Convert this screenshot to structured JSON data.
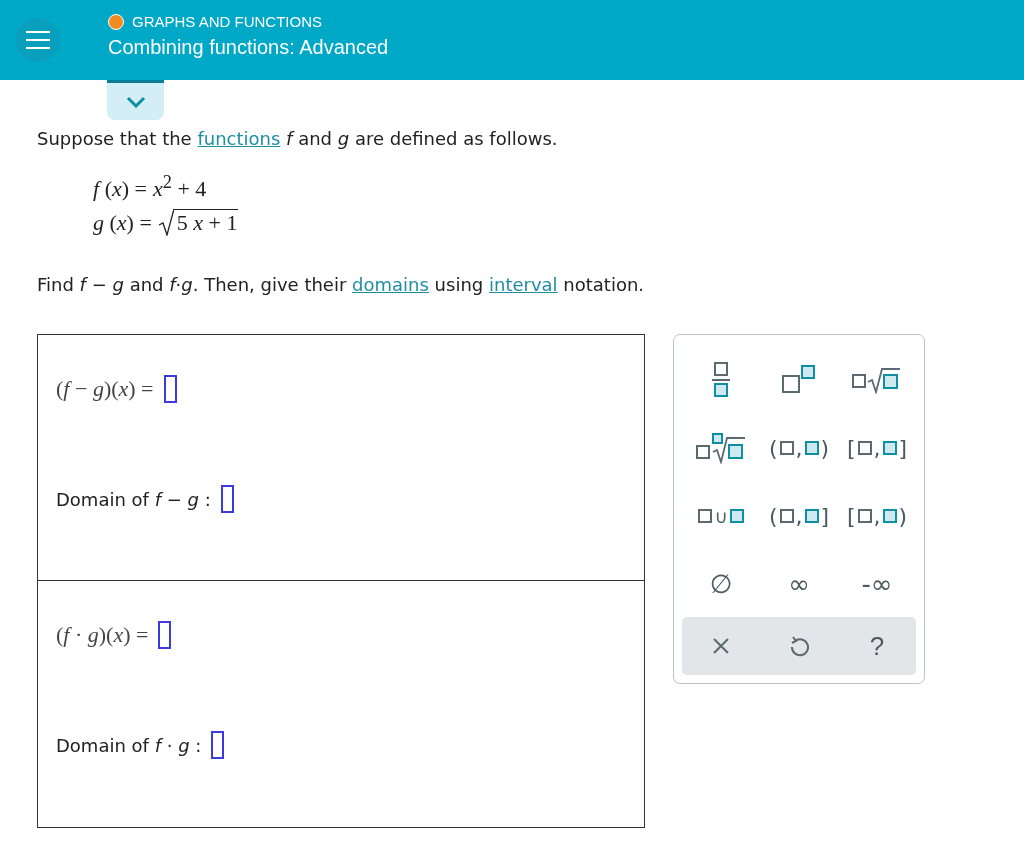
{
  "header": {
    "topic": "GRAPHS AND FUNCTIONS",
    "title": "Combining functions: Advanced"
  },
  "intro": [
    {
      "kind": "text",
      "text": "Suppose that the"
    },
    {
      "kind": "link",
      "text": "functions"
    },
    {
      "kind": "text",
      "text": "*f* and *g* are defined as follows."
    }
  ],
  "definitions": [
    {
      "kind": "plain",
      "lhs": "*f* (*x*) =",
      "rhs": "*x*$^{2}$ + 4"
    },
    {
      "kind": "sqrt",
      "lhs": "*g* (*x*) =",
      "rhs": "5 *x* + 1"
    }
  ],
  "question": [
    {
      "kind": "text",
      "text": "Find *f* − *g* and *f*·*g*. Then, give their"
    },
    {
      "kind": "link",
      "text": "domains"
    },
    {
      "kind": "text",
      "text": "using"
    },
    {
      "kind": "link",
      "text": "interval"
    },
    {
      "kind": "text",
      "text": "notation."
    }
  ],
  "answers": [
    {
      "expression": "(*f* − *g*)(*x*) =",
      "domain_label": "Domain of *f* − *g* :"
    },
    {
      "expression": "(*f* · *g*)(*x*) =",
      "domain_label": "Domain of *f* · *g* :"
    }
  ],
  "keypad": {
    "keys": [
      {
        "kind": "fraction"
      },
      {
        "kind": "power"
      },
      {
        "kind": "sqrt"
      },
      {
        "kind": "nthroot"
      },
      {
        "kind": "interval",
        "open": "(",
        "separator": ",",
        "close": ")"
      },
      {
        "kind": "interval",
        "open": "[",
        "separator": ",",
        "close": "]"
      },
      {
        "kind": "union",
        "symbol": "∪"
      },
      {
        "kind": "interval",
        "open": "(",
        "separator": ",",
        "close": "]"
      },
      {
        "kind": "interval",
        "open": "[",
        "separator": ",",
        "close": ")"
      },
      {
        "kind": "symbol",
        "label": "∅"
      },
      {
        "kind": "symbol",
        "label": "∞"
      },
      {
        "kind": "symbol",
        "label": "-∞"
      }
    ],
    "actions": [
      {
        "kind": "clear"
      },
      {
        "kind": "undo"
      },
      {
        "kind": "help",
        "label": "?"
      }
    ]
  }
}
